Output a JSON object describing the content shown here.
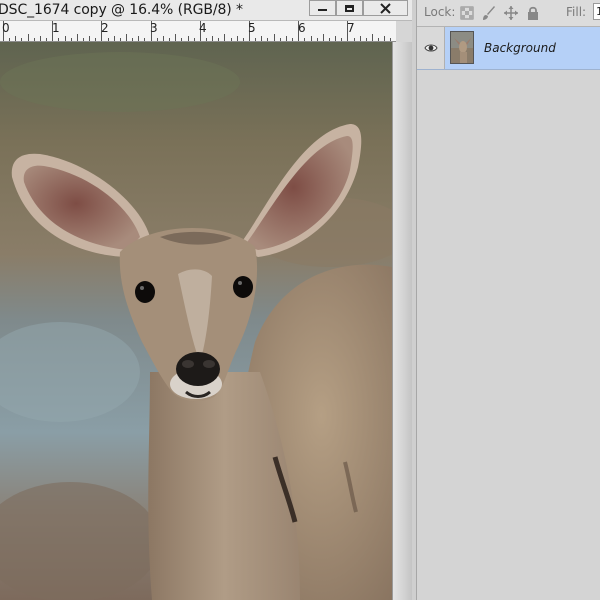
{
  "document": {
    "title": "DSC_1674 copy @ 16.4% (RGB/8) *",
    "ruler_labels": [
      "0",
      "1",
      "2",
      "3",
      "4",
      "5",
      "6",
      "7"
    ]
  },
  "window_controls": {
    "minimize_icon": "minimize-icon",
    "maximize_icon": "maximize-icon",
    "close_icon": "close-x-icon"
  },
  "layers_panel": {
    "lock_label": "Lock:",
    "lock_icons": [
      "lock-transparent-pixels-icon",
      "lock-image-pixels-icon",
      "lock-position-icon",
      "lock-all-icon"
    ],
    "fill_label": "Fill:",
    "fill_value": "1",
    "layers": [
      {
        "name": "Background",
        "visible": true,
        "selected": true
      }
    ]
  },
  "colors": {
    "selected_layer": "#b5d0f7",
    "panel_bg": "#d4d4d4",
    "titlebar_bg": "#e9e9e9"
  }
}
